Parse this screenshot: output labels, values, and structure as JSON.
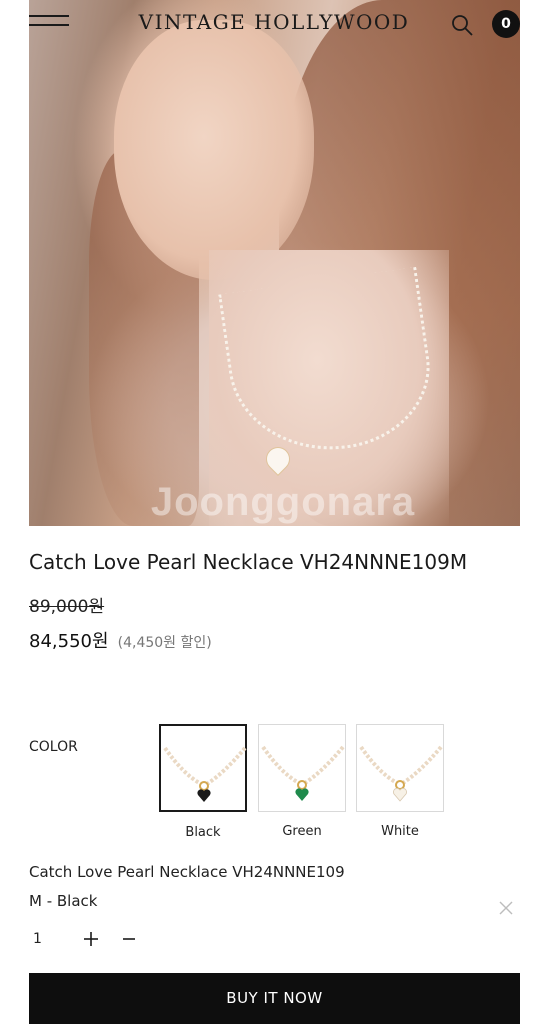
{
  "header": {
    "brand": "VINTAGE HOLLYWOOD",
    "cart_count": "0"
  },
  "hero": {
    "watermark": "Joonggonara"
  },
  "product": {
    "title": "Catch Love Pearl Necklace VH24NNNE109M",
    "original_price": "89,000원",
    "sale_price": "84,550원",
    "discount_text": "(4,450원 할인)"
  },
  "options": {
    "color_label": "COLOR",
    "colors": [
      {
        "label": "Black",
        "pendant_color": "#1a1a1a",
        "selected": true
      },
      {
        "label": "Green",
        "pendant_color": "#1f8a4c",
        "selected": false
      },
      {
        "label": "White",
        "pendant_color": "#f7f1e6",
        "selected": false
      }
    ]
  },
  "selection": {
    "line1": "Catch Love Pearl Necklace VH24NNNE109",
    "line2": "M - Black",
    "quantity": "1"
  },
  "actions": {
    "buy_label": "BUY IT NOW"
  },
  "colors": {
    "button_bg": "#0e0e0e",
    "badge_bg": "#111111"
  }
}
